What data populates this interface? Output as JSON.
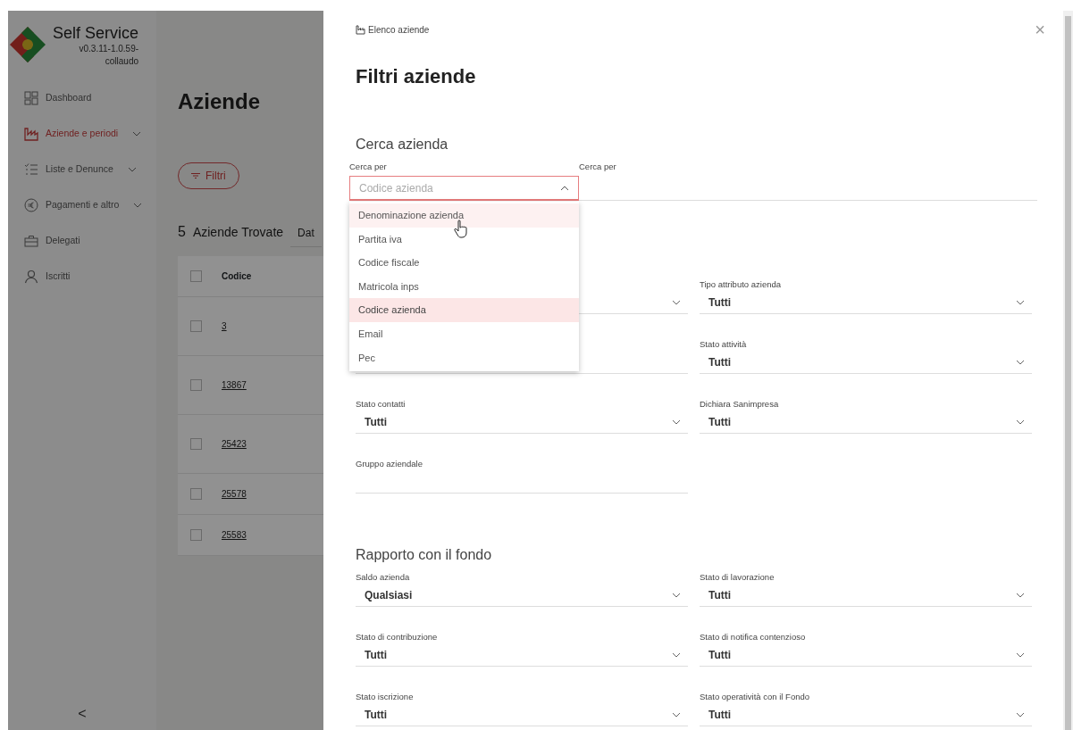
{
  "sidebar": {
    "title": "Self Service",
    "version": "v0.3.11-1.0.59-collaudo",
    "items": [
      {
        "label": "Dashboard",
        "active": false,
        "submenu": false
      },
      {
        "label": "Aziende e periodi",
        "active": true,
        "submenu": true
      },
      {
        "label": "Liste e Denunce",
        "active": false,
        "submenu": true
      },
      {
        "label": "Pagamenti e altro",
        "active": false,
        "submenu": true
      },
      {
        "label": "Delegati",
        "active": false,
        "submenu": false
      },
      {
        "label": "Iscritti",
        "active": false,
        "submenu": false
      }
    ],
    "collapse": "<"
  },
  "main": {
    "title": "Aziende",
    "filter_button": "Filtri",
    "result_count": "5",
    "result_label": "Aziende Trovate",
    "tab_partial": "Dat",
    "table": {
      "select_all_checked": false,
      "columns": [
        "Codice"
      ],
      "rows": [
        {
          "code": "3",
          "checked": false
        },
        {
          "code": "13867",
          "checked": false
        },
        {
          "code": "25423",
          "checked": false
        },
        {
          "code": "25578",
          "checked": false
        },
        {
          "code": "25583",
          "checked": false
        }
      ]
    }
  },
  "drawer": {
    "breadcrumb": "Elenco aziende",
    "close": "×",
    "title": "Filtri aziende",
    "sections": [
      {
        "title": "Cerca azienda",
        "search": {
          "select_label": "Cerca per",
          "placeholder": "Codice azienda",
          "open": true,
          "input_label": "Cerca per",
          "options": [
            {
              "label": "Denominazione azienda",
              "selected": false,
              "hovered": true
            },
            {
              "label": "Partita iva",
              "selected": false,
              "hovered": false
            },
            {
              "label": "Codice fiscale",
              "selected": false,
              "hovered": false
            },
            {
              "label": "Matricola inps",
              "selected": false,
              "hovered": false
            },
            {
              "label": "Codice azienda",
              "selected": true,
              "hovered": false
            },
            {
              "label": "Email",
              "selected": false,
              "hovered": false
            },
            {
              "label": "Pec",
              "selected": false,
              "hovered": false
            }
          ]
        },
        "fields": [
          {
            "kind": "select"
          },
          {
            "kind": "select",
            "label": "Tipo attributo azienda",
            "value": "Tutti"
          },
          {
            "kind": "text"
          },
          {
            "kind": "select",
            "label": "Stato attività",
            "value": "Tutti"
          },
          {
            "kind": "select",
            "label": "Stato contatti",
            "value": "Tutti"
          },
          {
            "kind": "select",
            "label": "Dichiara Sanimpresa",
            "value": "Tutti"
          },
          {
            "kind": "text",
            "label": "Gruppo aziendale"
          }
        ]
      },
      {
        "title": "Rapporto con il fondo",
        "fields": [
          {
            "kind": "select",
            "label": "Saldo azienda",
            "value": "Qualsiasi"
          },
          {
            "kind": "select",
            "label": "Stato di lavorazione",
            "value": "Tutti"
          },
          {
            "kind": "select",
            "label": "Stato di contribuzione",
            "value": "Tutti"
          },
          {
            "kind": "select",
            "label": "Stato di notifica contenzioso",
            "value": "Tutti"
          },
          {
            "kind": "select",
            "label": "Stato iscrizione",
            "value": "Tutti"
          },
          {
            "kind": "select",
            "label": "Stato operatività con il Fondo",
            "value": "Tutti"
          }
        ]
      }
    ]
  }
}
